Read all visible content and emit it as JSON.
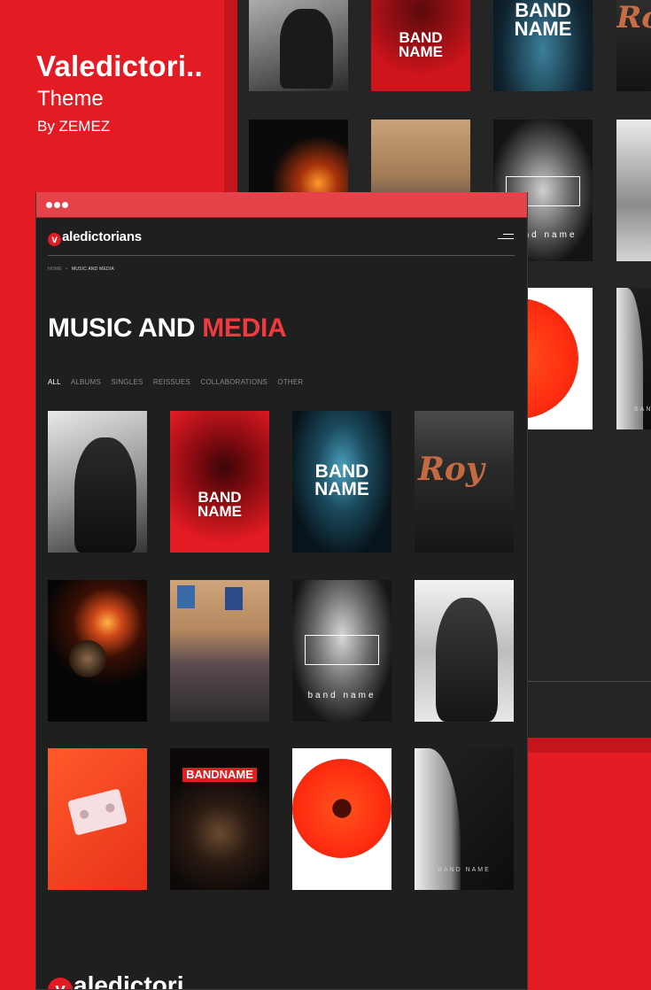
{
  "promo": {
    "title": "Valedictori..",
    "subtitle": "Theme",
    "author": "By ZEMEZ"
  },
  "site": {
    "logo_initial": "v",
    "logo_rest": "aledictorians",
    "breadcrumb_home": "HOME",
    "breadcrumb_sep": "•",
    "breadcrumb_current": "MUSIC AND MEDIA",
    "title_main": "MUSIC AND ",
    "title_accent": "MEDIA",
    "filters": [
      "ALL",
      "ALBUMS",
      "SINGLES",
      "REISSUES",
      "COLLABORATIONS",
      "OTHER"
    ],
    "footer_logo_initial": "v",
    "footer_logo_rest": "aledictori"
  },
  "cover_labels": {
    "band_name_1": "BAND",
    "band_name_2": "NAME",
    "band_name_lower": "band name",
    "band_name_spaced": "BAND NAME",
    "bandname_banner": "BANDNAME",
    "roy_fragment": "Roy"
  },
  "colors": {
    "brand_red": "#e31b23",
    "dark_red": "#c4151c",
    "window_bg": "#1f1f1f",
    "titlebar": "#e6424a",
    "accent": "#ef3b3f"
  },
  "icons": [
    "window-dot-icon",
    "menu-icon",
    "logo-badge-icon"
  ]
}
